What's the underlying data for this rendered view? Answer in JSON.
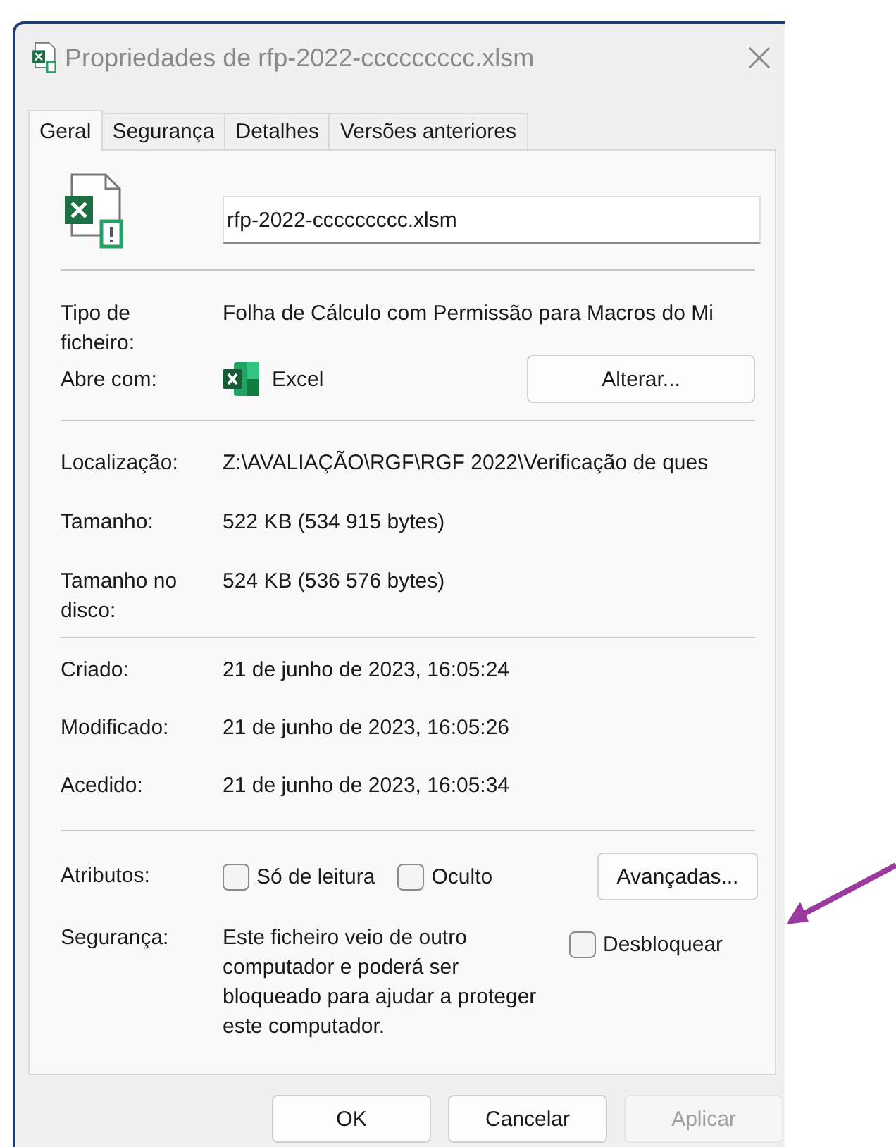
{
  "window": {
    "title": "Propriedades de rfp-2022-ccccccccc.xlsm"
  },
  "tabs": [
    {
      "label": "Geral",
      "selected": true
    },
    {
      "label": "Segurança",
      "selected": false
    },
    {
      "label": "Detalhes",
      "selected": false
    },
    {
      "label": "Versões anteriores",
      "selected": false
    }
  ],
  "file_name": "rfp-2022-ccccccccc.xlsm",
  "file_type": {
    "label": "Tipo de ficheiro:",
    "value": "Folha de Cálculo com Permissão para Macros do Mi"
  },
  "opens_with": {
    "label": "Abre com:",
    "app": "Excel",
    "button": "Alterar..."
  },
  "location": {
    "label": "Localização:",
    "value": "Z:\\AVALIAÇÃO\\RGF\\RGF 2022\\Verificação de ques"
  },
  "size": {
    "label": "Tamanho:",
    "value": "522 KB (534 915 bytes)"
  },
  "size_on_disk": {
    "label": "Tamanho no disco:",
    "value": "524 KB (536 576 bytes)"
  },
  "dates": [
    {
      "label": "Criado:",
      "value": "21 de junho de 2023, 16:05:24"
    },
    {
      "label": "Modificado:",
      "value": "21 de junho de 2023, 16:05:26"
    },
    {
      "label": "Acedido:",
      "value": "21 de junho de 2023, 16:05:34"
    }
  ],
  "attributes": {
    "label": "Atributos:",
    "checkboxes": [
      {
        "label": "Só de leitura",
        "checked": false
      },
      {
        "label": "Oculto",
        "checked": false
      }
    ],
    "button": "Avançadas..."
  },
  "security": {
    "label": "Segurança:",
    "text": "Este ficheiro veio de outro computador e poderá ser bloqueado para ajudar a proteger este computador.",
    "unblock": {
      "label": "Desbloquear",
      "checked": false
    }
  },
  "buttons": [
    {
      "label": "OK",
      "disabled": false
    },
    {
      "label": "Cancelar",
      "disabled": false
    },
    {
      "label": "Aplicar",
      "disabled": true
    }
  ]
}
